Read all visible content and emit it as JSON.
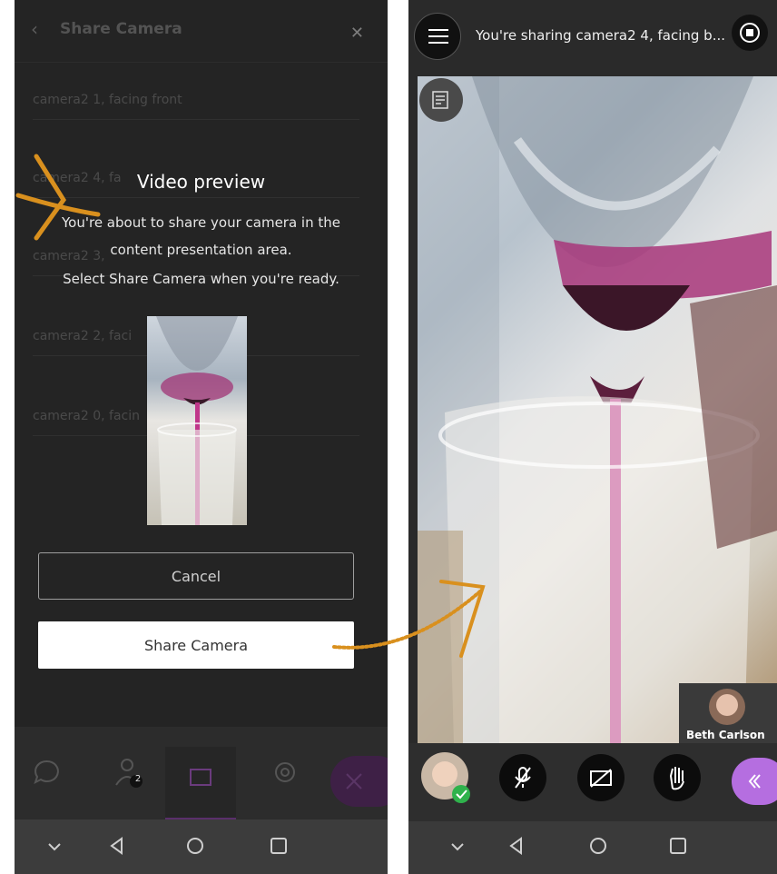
{
  "left": {
    "header": {
      "title": "Share Camera"
    },
    "cameras": [
      {
        "label": "camera2 1, facing front"
      },
      {
        "label": "camera2 4, fa"
      },
      {
        "label": "camera2 3,"
      },
      {
        "label": "camera2 2, faci"
      },
      {
        "label": "camera2 0, facin"
      }
    ],
    "dialog": {
      "title": "Video preview",
      "line1": "You're about to share your camera in the",
      "line2": "content presentation area.",
      "line3": "Select Share Camera when you're ready.",
      "cancel_label": "Cancel",
      "share_label": "Share Camera"
    },
    "badge_count": "2"
  },
  "right": {
    "status_text": "You're sharing camera2 4, facing b...",
    "participant": {
      "name": "Beth Carlson"
    }
  },
  "colors": {
    "accent": "#b56ee0",
    "annotation_arrow": "#d9901e",
    "status_ok": "#2fb24c"
  },
  "icons": [
    "back-icon",
    "close-icon",
    "chat-icon",
    "participants-icon",
    "share-content-icon",
    "settings-icon",
    "leave-icon",
    "hamburger-icon",
    "stop-sharing-icon",
    "captions-icon",
    "mic-off-icon",
    "camera-off-icon",
    "raise-hand-icon",
    "collapse-icon",
    "nav-down-icon",
    "nav-back-icon",
    "nav-home-icon",
    "nav-recents-icon"
  ]
}
